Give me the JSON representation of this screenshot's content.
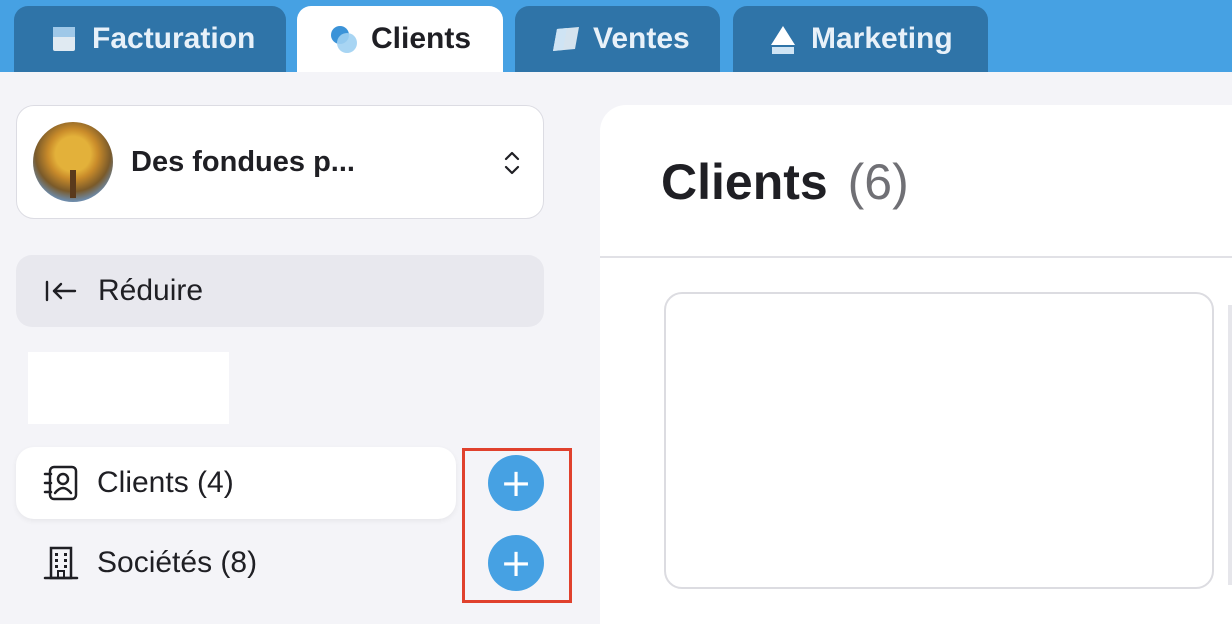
{
  "tabs": [
    {
      "label": "Facturation",
      "icon": "invoice-icon",
      "active": false
    },
    {
      "label": "Clients",
      "icon": "clients-bubbles-icon",
      "active": true
    },
    {
      "label": "Ventes",
      "icon": "ventes-icon",
      "active": false
    },
    {
      "label": "Marketing",
      "icon": "marketing-icon",
      "active": false
    }
  ],
  "sidebar": {
    "org_name": "Des fondues p...",
    "collapse_label": "Réduire",
    "items": [
      {
        "label": "Clients (4)",
        "icon": "contacts-book-icon",
        "active": true
      },
      {
        "label": "Sociétés (8)",
        "icon": "building-icon",
        "active": false
      }
    ],
    "add_symbol": "+"
  },
  "main": {
    "title": "Clients",
    "count": "(6)"
  },
  "colors": {
    "topbar": "#46a1e3",
    "tab_inactive": "#2f74a8",
    "accent": "#46a1e3",
    "highlight": "#e0412d"
  }
}
